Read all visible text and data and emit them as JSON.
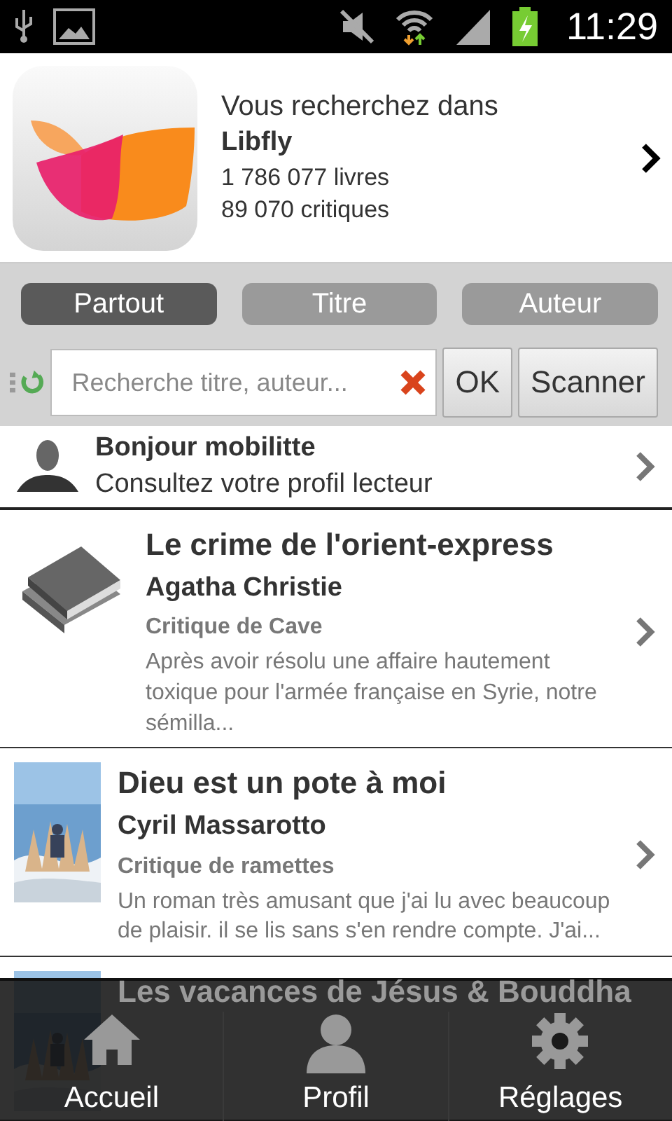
{
  "status_bar": {
    "time": "11:29"
  },
  "header": {
    "intro": "Vous recherchez dans",
    "library": "Libfly",
    "books": "1 786 077 livres",
    "reviews": "89 070 critiques"
  },
  "tabs": [
    {
      "label": "Partout",
      "selected": true
    },
    {
      "label": "Titre",
      "selected": false
    },
    {
      "label": "Auteur",
      "selected": false
    }
  ],
  "search": {
    "placeholder": "Recherche titre, auteur...",
    "ok": "OK",
    "scan": "Scanner"
  },
  "profile": {
    "greeting": "Bonjour mobilitte",
    "link": "Consultez votre profil lecteur"
  },
  "reviews": [
    {
      "kind": "no-cover",
      "title": "Le crime de l'orient-express",
      "author": "Agatha Christie",
      "critic": "Critique de Cave",
      "excerpt": "Après avoir résolu une affaire hautement toxique pour l'armée française en Syrie, notre sémilla..."
    },
    {
      "kind": "cover",
      "title": "Dieu est un pote à moi",
      "author": "Cyril Massarotto",
      "critic": "Critique de ramettes",
      "excerpt": "Un roman très amusant que j'ai lu avec beaucoup de plaisir. il se lis sans s'en rendre compte. J'ai..."
    },
    {
      "kind": "cover",
      "title": "Les vacances de Jésus & Bouddha"
    }
  ],
  "nav": [
    {
      "kind": "home",
      "label": "Accueil"
    },
    {
      "kind": "person",
      "label": "Profil"
    },
    {
      "kind": "gear",
      "label": "Réglages"
    }
  ]
}
